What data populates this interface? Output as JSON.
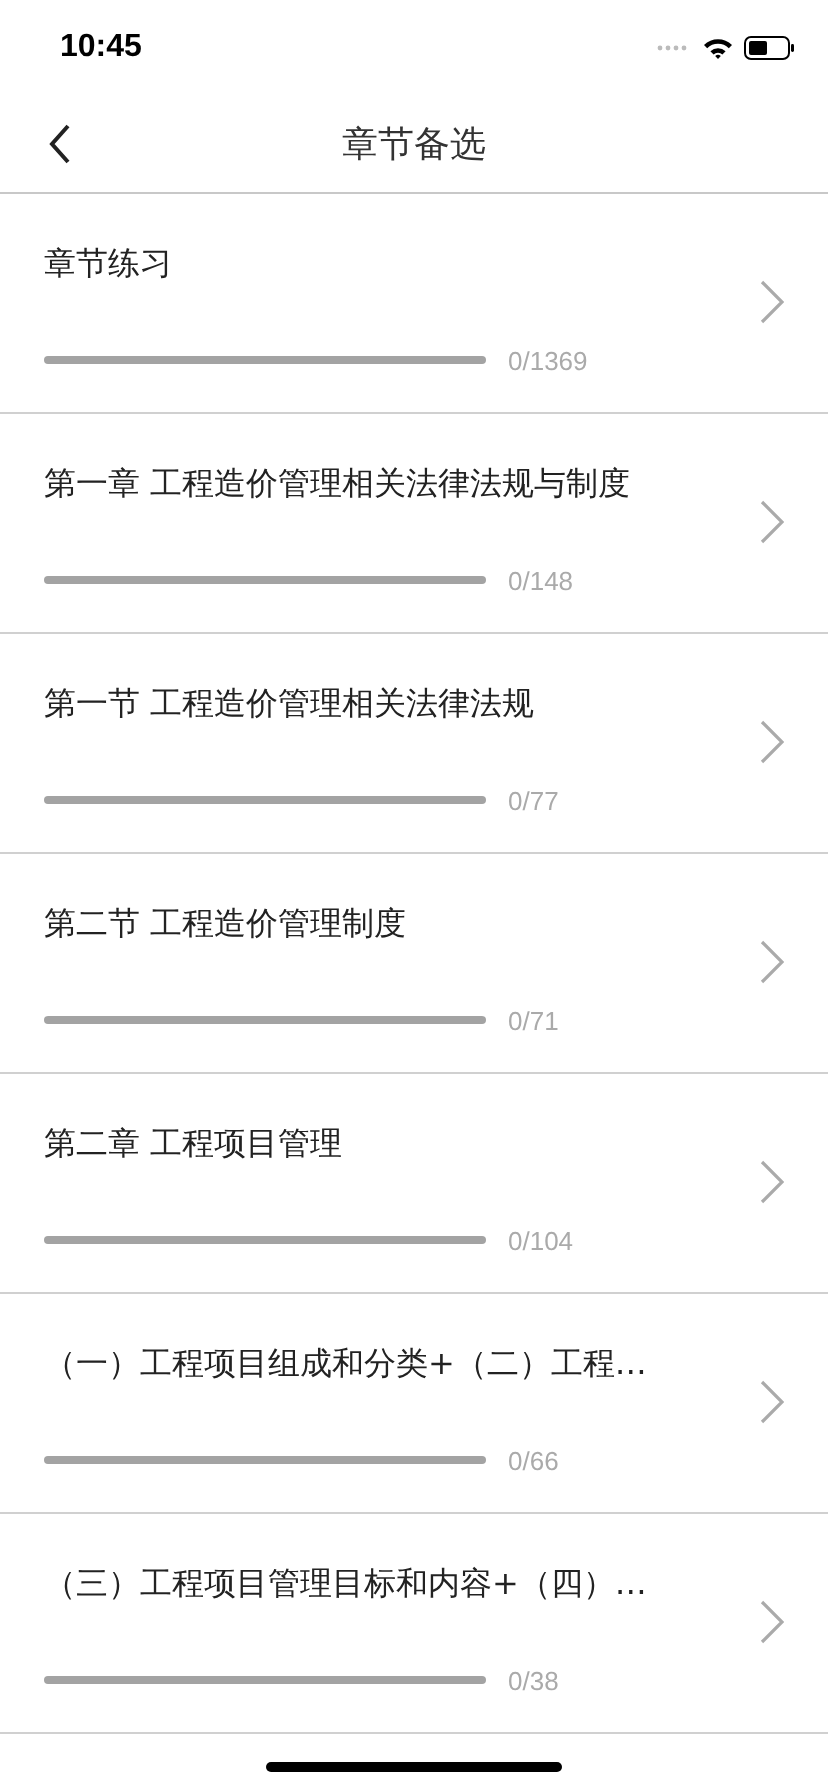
{
  "status_bar": {
    "time": "10:45"
  },
  "nav": {
    "title": "章节备选"
  },
  "chapters": [
    {
      "title": "章节练习",
      "level": 0,
      "count": "0/1369"
    },
    {
      "title": "第一章 工程造价管理相关法律法规与制度",
      "level": 0,
      "count": "0/148"
    },
    {
      "title": "第一节 工程造价管理相关法律法规",
      "level": 0,
      "count": "0/77"
    },
    {
      "title": "第二节 工程造价管理制度",
      "level": 0,
      "count": "0/71"
    },
    {
      "title": "第二章 工程项目管理",
      "level": 0,
      "count": "0/104"
    },
    {
      "title": "（一）工程项目组成和分类+（二）工程…",
      "level": 0,
      "count": "0/66"
    },
    {
      "title": "（三）工程项目管理目标和内容+（四）…",
      "level": 0,
      "count": "0/38"
    }
  ]
}
